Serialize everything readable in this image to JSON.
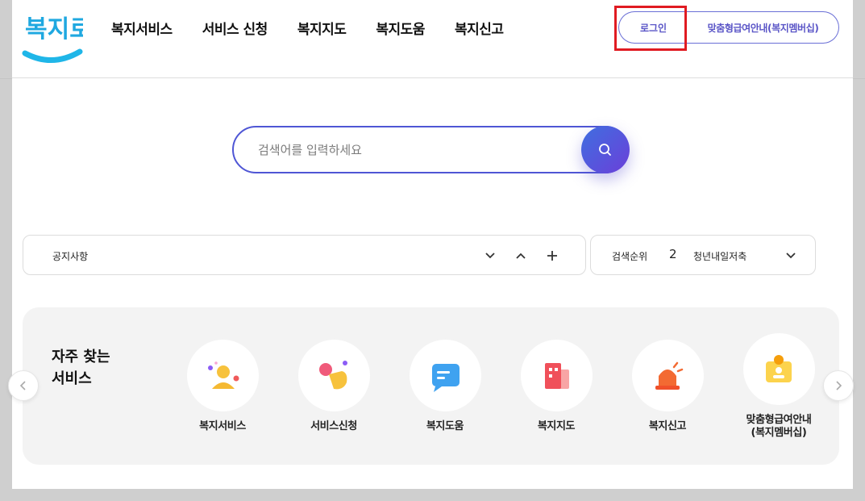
{
  "logo": {
    "text": "복지로"
  },
  "nav": [
    "복지서비스",
    "서비스 신청",
    "복지지도",
    "복지도움",
    "복지신고"
  ],
  "header_buttons": {
    "login": "로그인",
    "membership": "맞춤형급여안내(복지멤버십)"
  },
  "search": {
    "placeholder": "검색어를 입력하세요"
  },
  "notice": {
    "label": "공지사항"
  },
  "ranking": {
    "label": "검색순위",
    "rank": "2",
    "keyword": "청년내일저축"
  },
  "quick": {
    "title_line1": "자주 찾는",
    "title_line2": "서비스",
    "items": [
      {
        "label": "복지서비스",
        "icon": "welfare-service-icon"
      },
      {
        "label": "서비스신청",
        "icon": "service-apply-icon"
      },
      {
        "label": "복지도움",
        "icon": "welfare-help-icon"
      },
      {
        "label": "복지지도",
        "icon": "welfare-map-icon"
      },
      {
        "label": "복지신고",
        "icon": "welfare-report-icon"
      },
      {
        "label": "맞춤형급여안내\n(복지멤버십)",
        "icon": "membership-icon"
      }
    ]
  },
  "colors": {
    "accent": "#4f56d5",
    "highlight": "#e01b22",
    "logo_blue": "#1fb6e8"
  }
}
